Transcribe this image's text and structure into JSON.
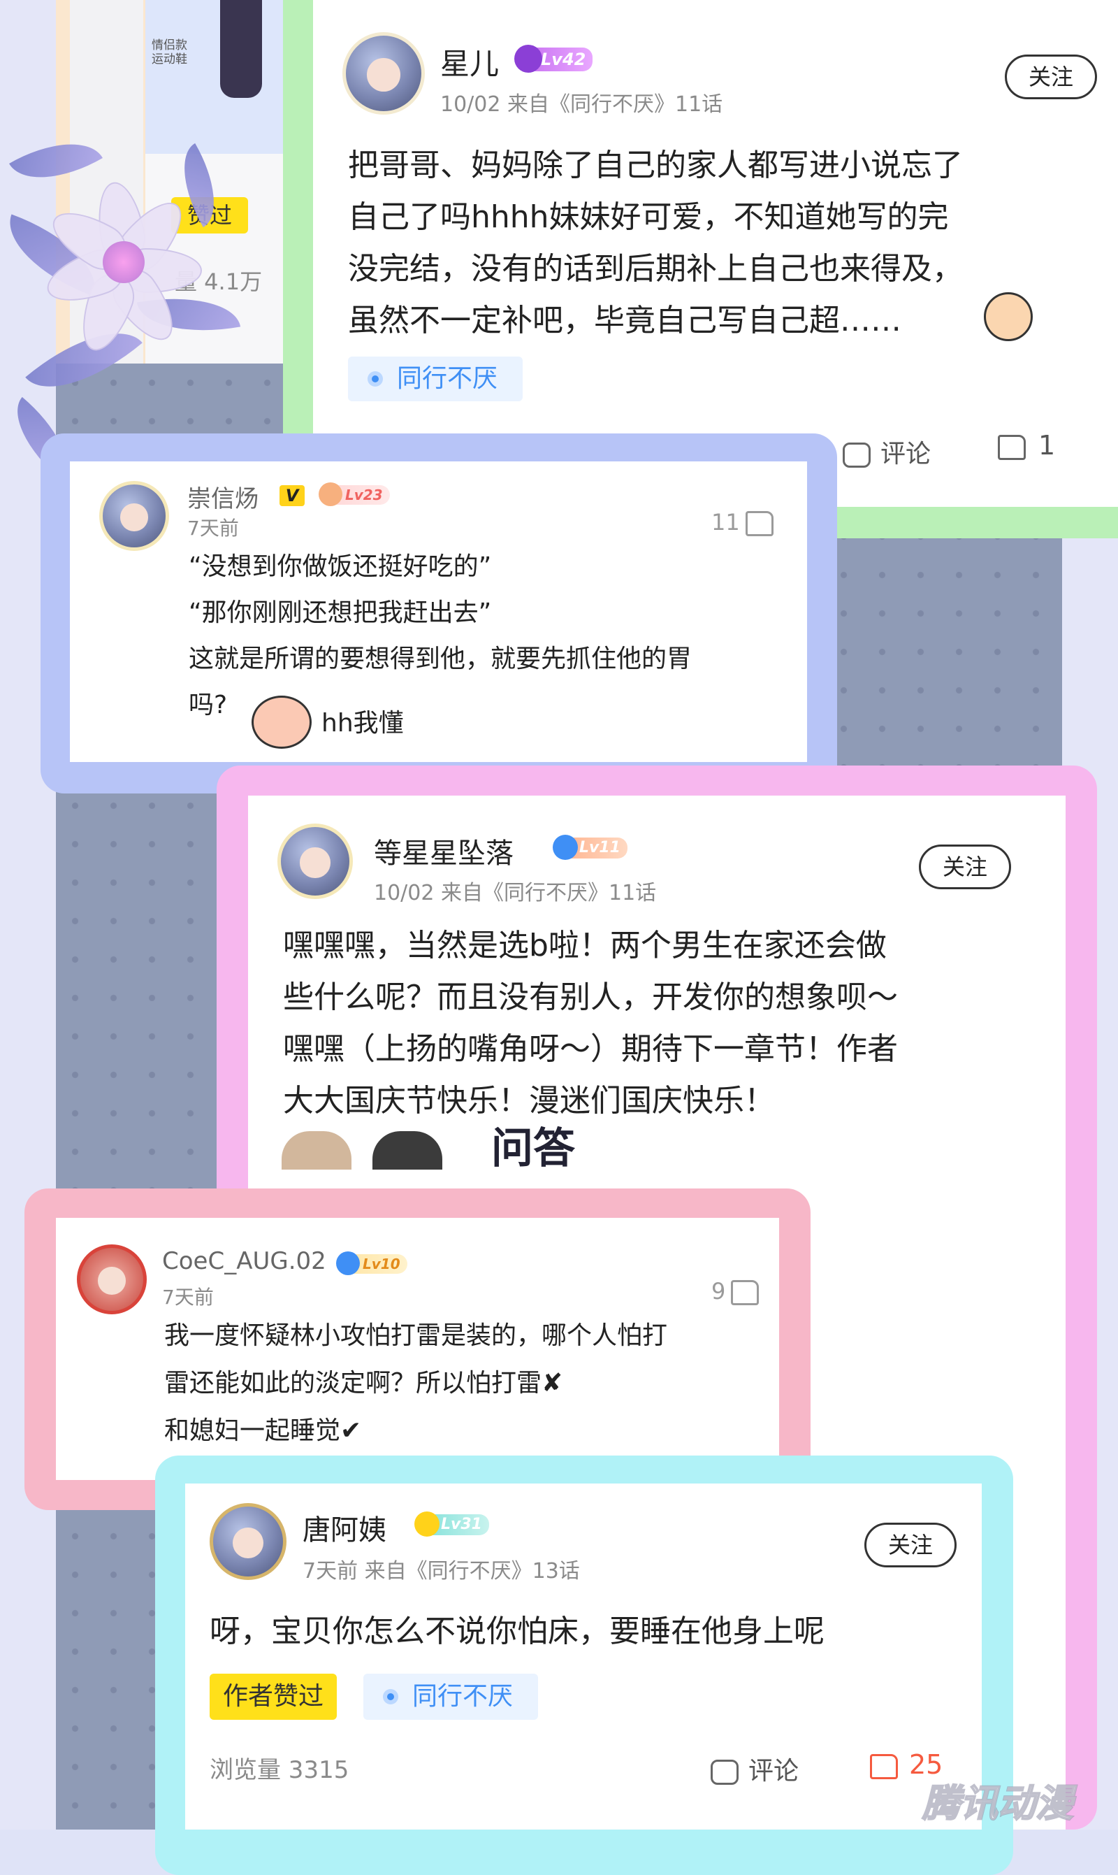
{
  "colors": {
    "card1_frame": "#baf0b7",
    "card2_frame": "#b7c4f7",
    "card3_frame": "#f7b7ee",
    "card4_frame": "#f7b7c8",
    "card5_frame": "#b0f2f7",
    "tag_blue": "#3f8ff5",
    "like_red": "#f55a3f"
  },
  "bg_card": {
    "badge": "赞过",
    "views": "量 4.1万",
    "sticker": "情侣款\n运动鞋"
  },
  "comments": [
    {
      "user": "星儿",
      "level": "Lv42",
      "meta": "10/02 来自《同行不厌》11话",
      "follow": "关注",
      "text": "把哥哥、妈妈除了自己的家人都写进小说忘了\n自己了吗hhhh妹妹好可爱，不知道她写的完\n没完结，没有的话到后期补上自己也来得及，\n虽然不一定补吧，毕竟自己写自己超……",
      "tag": "同行不厌",
      "comment_label": "评论",
      "likes": "1"
    },
    {
      "user": "崇信炀",
      "vip": "V",
      "level": "Lv23",
      "time": "7天前",
      "likes": "11",
      "text": "“没想到你做饭还挺好吃的”\n“那你刚刚还想把我赶出去”\n这就是所谓的要想得到他，就要先抓住他的胃\n吗?",
      "text_tail": "hh我懂"
    },
    {
      "user": "等星星坠落",
      "level": "Lv11",
      "meta": "10/02 来自《同行不厌》11话",
      "follow": "关注",
      "text": "嘿嘿嘿，当然是选b啦！两个男生在家还会做\n些什么呢？而且没有别人，开发你的想象呗～\n嘿嘿（上扬的嘴角呀～）期待下一章节！作者\n大大国庆节快乐！漫迷们国庆快乐！",
      "image_caption": "问答"
    },
    {
      "user": "CoeC_AUG.02",
      "level": "Lv10",
      "time": "7天前",
      "likes": "9",
      "text": "我一度怀疑林小攻怕打雷是装的，哪个人怕打\n雷还能如此的淡定啊？所以怕打雷✘\n和媳妇一起睡觉✔"
    },
    {
      "user": "唐阿姨",
      "level": "Lv31",
      "meta": "7天前 来自《同行不厌》13话",
      "follow": "关注",
      "text": "呀，宝贝你怎么不说你怕床，要睡在他身上呢",
      "author_badge": "作者赞过",
      "tag": "同行不厌",
      "views": "浏览量 3315",
      "comment_label": "评论",
      "likes": "25"
    }
  ],
  "watermark": "腾讯动漫"
}
